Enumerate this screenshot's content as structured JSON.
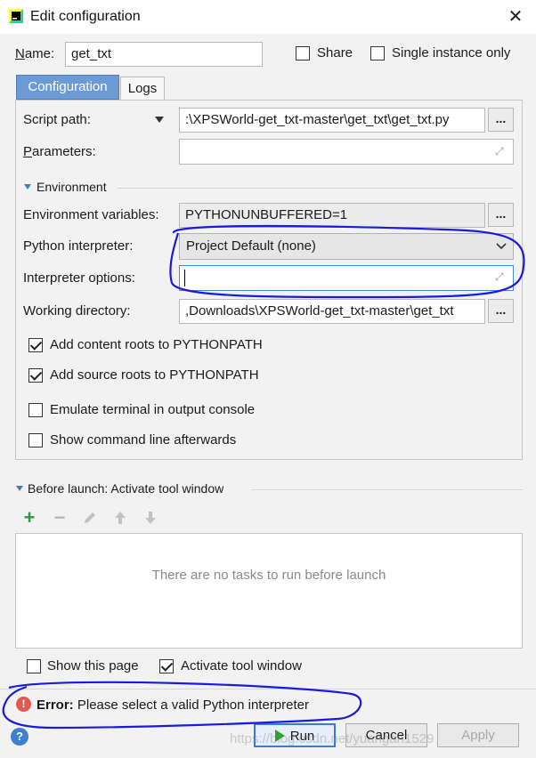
{
  "window": {
    "title": "Edit configuration",
    "close_label": "✕"
  },
  "name_field": {
    "label": "Name:",
    "value": "get_txt"
  },
  "share": {
    "label": "Share",
    "checked": false
  },
  "single_instance": {
    "label": "Single instance only",
    "checked": false
  },
  "tabs": [
    {
      "label": "Configuration"
    },
    {
      "label": "Logs"
    }
  ],
  "script_path": {
    "label": "Script path:",
    "value": ":\\XPSWorld-get_txt-master\\get_txt\\get_txt.py",
    "button": "..."
  },
  "parameters": {
    "label": "Parameters:",
    "value": ""
  },
  "environment": {
    "section_label": "Environment",
    "env_vars": {
      "label": "Environment variables:",
      "value": "PYTHONUNBUFFERED=1",
      "button": "..."
    },
    "interpreter": {
      "label": "Python interpreter:",
      "value": "Project Default (none)"
    },
    "interpreter_options": {
      "label": "Interpreter options:",
      "value": ""
    },
    "working_dir": {
      "label": "Working directory:",
      "value": ",Downloads\\XPSWorld-get_txt-master\\get_txt",
      "button": "..."
    }
  },
  "checkboxes": [
    {
      "label": "Add content roots to PYTHONPATH",
      "checked": true
    },
    {
      "label": "Add source roots to PYTHONPATH",
      "checked": true
    },
    {
      "label": "Emulate terminal in output console",
      "checked": false
    },
    {
      "label": "Show command line afterwards",
      "checked": false
    }
  ],
  "before_launch": {
    "label": "Before launch: Activate tool window",
    "toolbar_icons": [
      "add-icon",
      "remove-icon",
      "edit-icon",
      "move-up-icon",
      "move-down-icon"
    ],
    "empty_text": "There are no tasks to run before launch"
  },
  "bottom_options": {
    "show_page": {
      "label": "Show this page",
      "checked": false
    },
    "activate_tool_window": {
      "label": "Activate tool window",
      "checked": true
    }
  },
  "error": {
    "prefix": "Error:",
    "message": " Please select a valid Python interpreter"
  },
  "buttons": {
    "run": "Run",
    "cancel": "Cancel",
    "apply": "Apply"
  },
  "watermark": "https://blog.csdn.net/yuangan1529",
  "colors": {
    "accent": "#6b9ad4",
    "annotation": "#1a1adc",
    "error": "#e05a4f",
    "run_green": "#2aa52a"
  }
}
